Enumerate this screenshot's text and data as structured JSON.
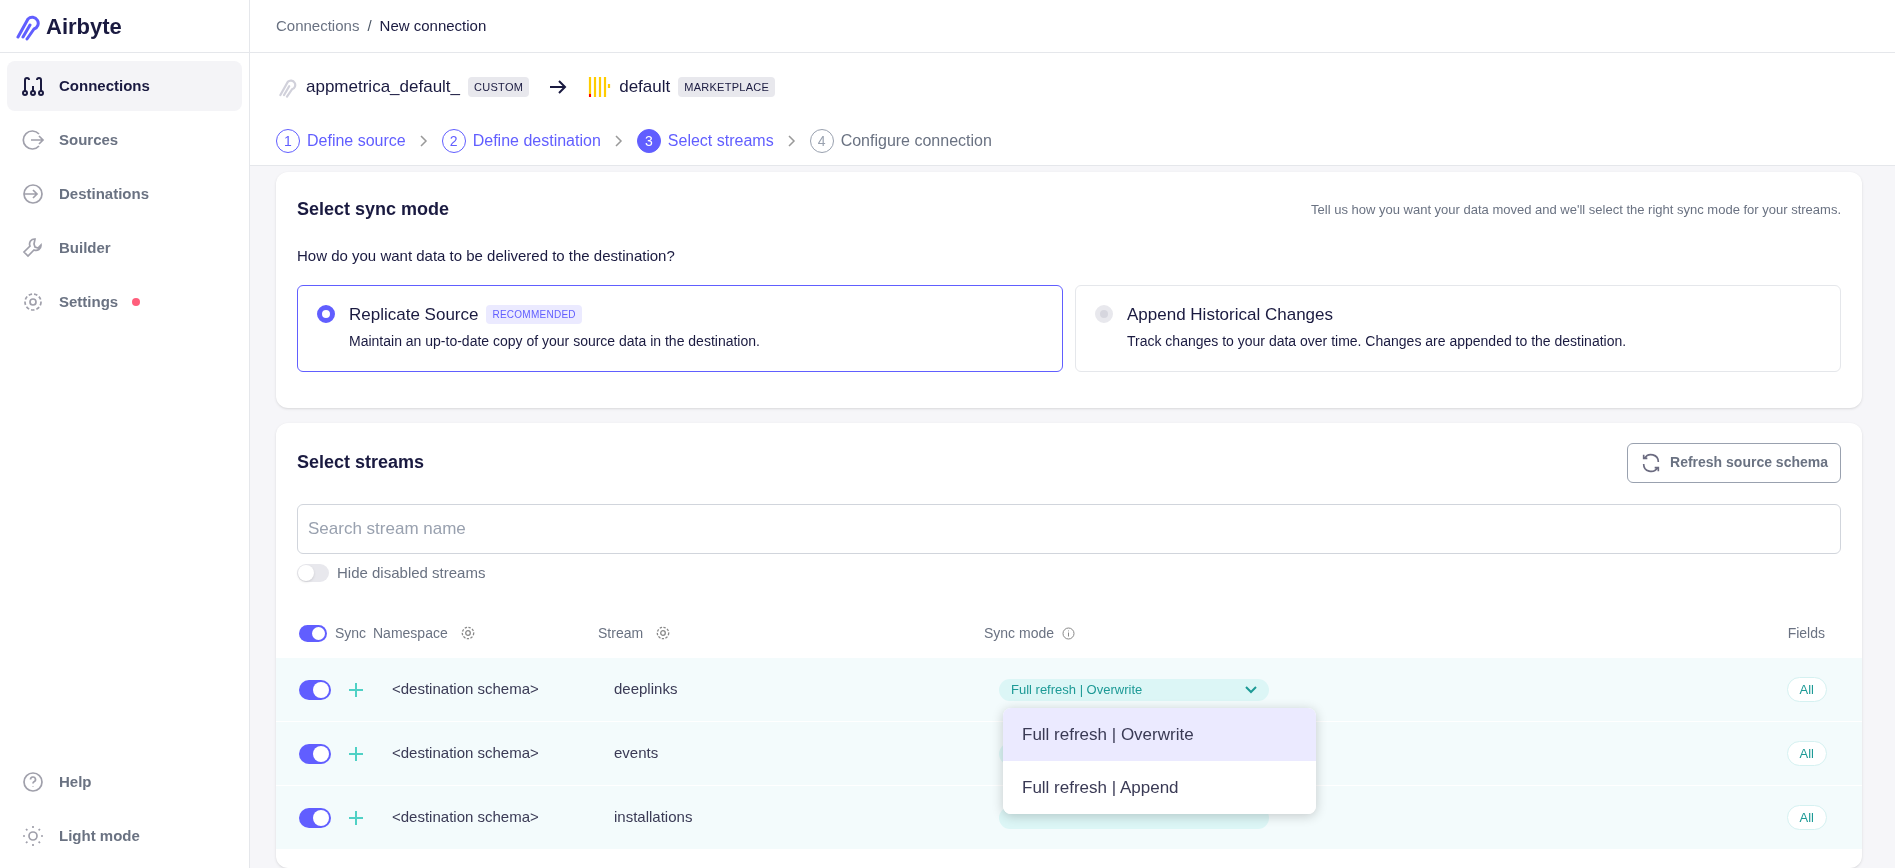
{
  "sidebar": {
    "logo": "Airbyte",
    "items": [
      {
        "label": "Connections",
        "kind": "connections",
        "selected": true,
        "notification": false
      },
      {
        "label": "Sources",
        "kind": "sources",
        "selected": false,
        "notification": false
      },
      {
        "label": "Destinations",
        "kind": "destinations",
        "selected": false,
        "notification": false
      },
      {
        "label": "Builder",
        "kind": "builder",
        "selected": false,
        "notification": false
      },
      {
        "label": "Settings",
        "kind": "settings",
        "selected": false,
        "notification": true
      }
    ],
    "footer": [
      {
        "label": "Help",
        "kind": "help"
      },
      {
        "label": "Light mode",
        "kind": "sun"
      }
    ]
  },
  "breadcrumb": {
    "items": [
      "Connections",
      "New connection"
    ],
    "separator": "/"
  },
  "connection": {
    "source": {
      "name": "appmetrica_default_",
      "tag": "CUSTOM"
    },
    "destination": {
      "name": "default",
      "tag": "MARKETPLACE"
    }
  },
  "steps": [
    {
      "number": "1",
      "label": "Define source",
      "selected": false,
      "completed": true
    },
    {
      "number": "2",
      "label": "Define destination",
      "selected": false,
      "completed": true
    },
    {
      "number": "3",
      "label": "Select streams",
      "selected": true,
      "completed": false
    },
    {
      "number": "4",
      "label": "Configure connection",
      "selected": false,
      "completed": false
    }
  ],
  "sync_mode": {
    "title": "Select sync mode",
    "hint": "Tell us how you want your data moved and we'll select the right sync mode for your streams.",
    "question": "How do you want data to be delivered to the destination?",
    "options": [
      {
        "title": "Replicate Source",
        "badge": "RECOMMENDED",
        "description": "Maintain an up-to-date copy of your source data in the destination.",
        "selected": true,
        "disabled": false
      },
      {
        "title": "Append Historical Changes",
        "description": "Track changes to your data over time. Changes are appended to the destination.",
        "selected": false,
        "disabled": true
      }
    ]
  },
  "streams": {
    "title": "Select streams",
    "refresh_button": "Refresh source schema",
    "search": {
      "placeholder": "Search stream name"
    },
    "hide_disabled": {
      "label": "Hide disabled streams",
      "on": false
    },
    "header": {
      "sync_on": true,
      "sync": "Sync",
      "namespace": "Namespace",
      "stream": "Stream",
      "sync_mode": "Sync mode",
      "fields": "Fields"
    },
    "rows": [
      {
        "on": true,
        "namespace": "<destination schema>",
        "stream": "deeplinks",
        "sync_mode": "Full refresh | Overwrite",
        "fields": "All"
      },
      {
        "on": true,
        "namespace": "<destination schema>",
        "stream": "events",
        "sync_mode_covered": true,
        "fields": "All"
      },
      {
        "on": true,
        "namespace": "<destination schema>",
        "stream": "installations",
        "sync_mode_covered": true,
        "fields": "All"
      }
    ],
    "dropdown": {
      "options": [
        {
          "label": "Full refresh | Overwrite",
          "selected": true
        },
        {
          "label": "Full refresh | Append",
          "selected": false
        }
      ]
    }
  }
}
